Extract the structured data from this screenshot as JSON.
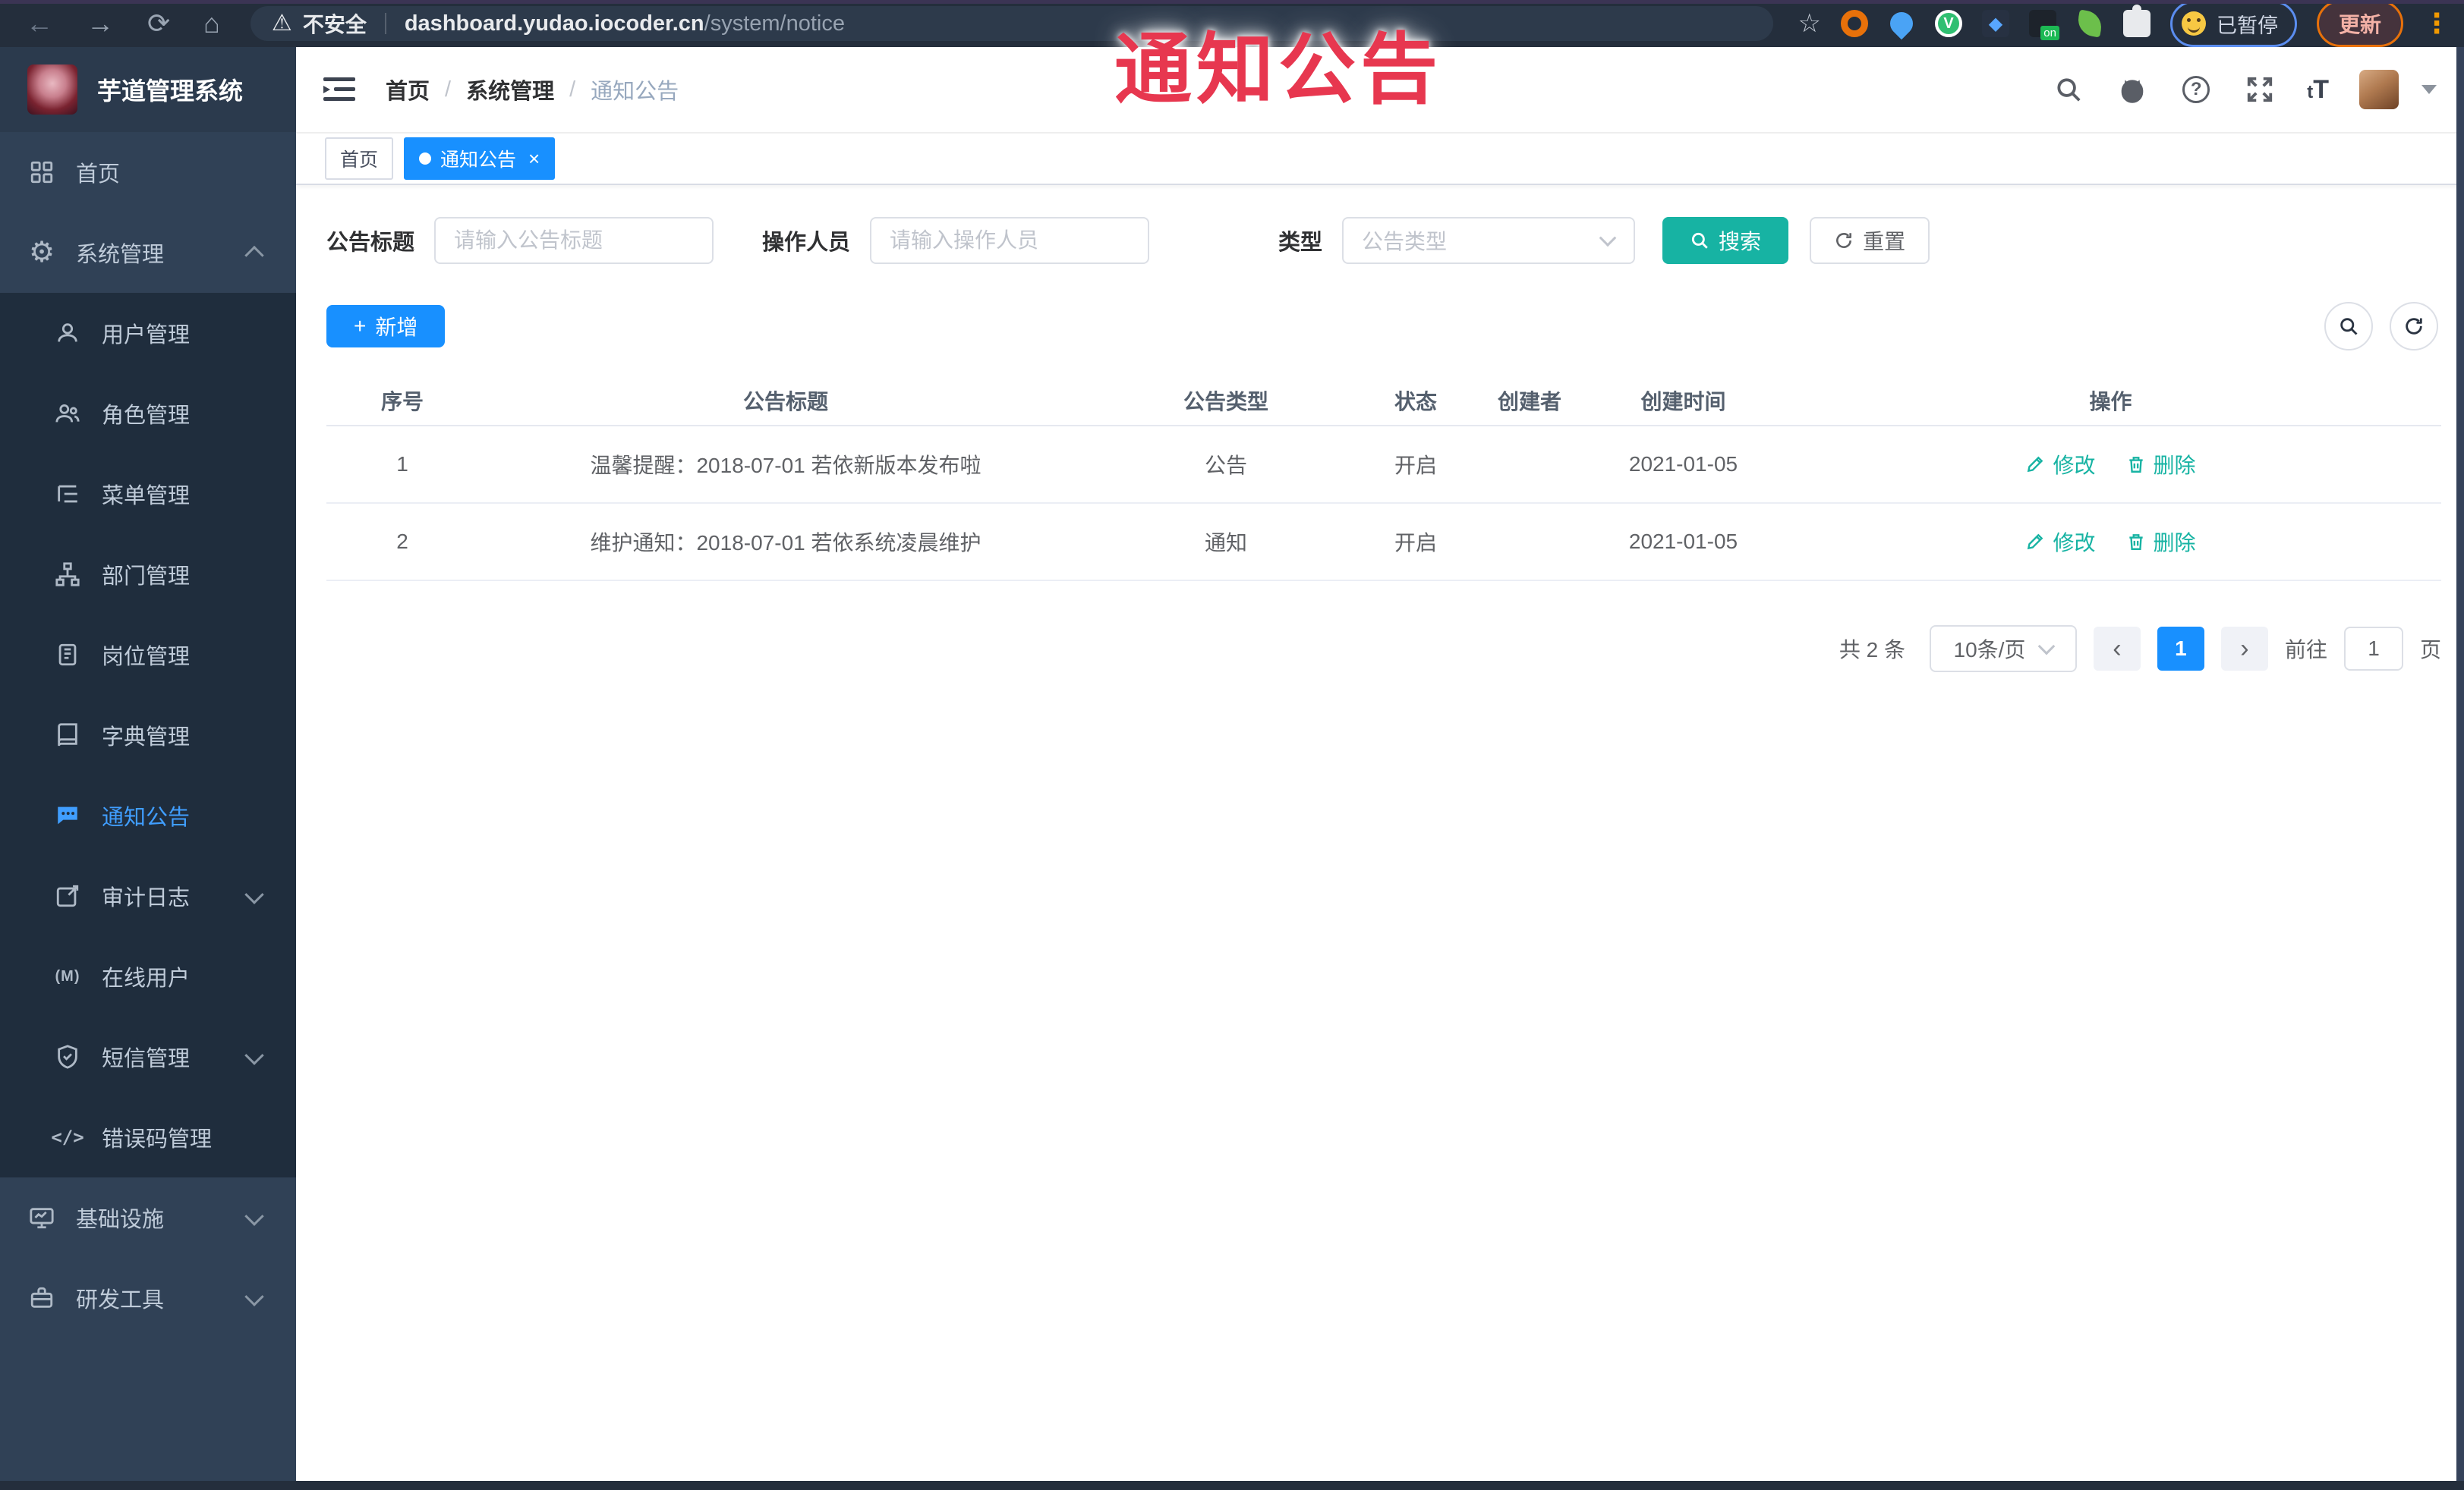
{
  "overlay": {
    "text": "通知公告",
    "color": "#e7374f"
  },
  "browser": {
    "security_label": "不安全",
    "url_host": "dashboard.yudao.iocoder.cn",
    "url_path": "/system/notice",
    "paused_label": "已暂停",
    "update_label": "更新",
    "ext_badge": "on",
    "kebab": "⋮",
    "back": "←",
    "forward": "→",
    "reload": "⟳",
    "home": "⌂",
    "star": "☆",
    "warning": "⚠"
  },
  "sidebar": {
    "title": "芋道管理系统",
    "items": [
      {
        "label": "首页",
        "icon": "dashboard-icon"
      },
      {
        "label": "系统管理",
        "icon": "gear-icon",
        "arrow": "up"
      },
      {
        "label": "用户管理",
        "icon": "user-icon"
      },
      {
        "label": "角色管理",
        "icon": "users-icon"
      },
      {
        "label": "菜单管理",
        "icon": "menu-tree-icon"
      },
      {
        "label": "部门管理",
        "icon": "org-tree-icon"
      },
      {
        "label": "岗位管理",
        "icon": "badge-icon"
      },
      {
        "label": "字典管理",
        "icon": "book-icon"
      },
      {
        "label": "通知公告",
        "icon": "message-icon",
        "active": true
      },
      {
        "label": "审计日志",
        "icon": "log-icon",
        "arrow": "down"
      },
      {
        "label": "在线用户",
        "icon": "online-user-icon"
      },
      {
        "label": "短信管理",
        "icon": "shield-icon",
        "arrow": "down"
      },
      {
        "label": "错误码管理",
        "icon": "code-icon"
      },
      {
        "label": "基础设施",
        "icon": "monitor-icon",
        "arrow": "down"
      },
      {
        "label": "研发工具",
        "icon": "toolbox-icon",
        "arrow": "down"
      }
    ],
    "gear_glyph": "⚙",
    "code_glyph": "</>"
  },
  "navbar": {
    "breadcrumb": [
      "首页",
      "系统管理",
      "通知公告"
    ],
    "separator": "/",
    "icons": [
      "search-icon",
      "github-icon",
      "question-icon",
      "fullscreen-icon",
      "font-size-icon",
      "avatar",
      "caret-down-icon"
    ],
    "font_size_glyph_small": "t",
    "font_size_glyph_big": "T",
    "question_glyph": "?"
  },
  "tags": [
    {
      "label": "首页",
      "active": false
    },
    {
      "label": "通知公告",
      "active": true,
      "close": "×"
    }
  ],
  "filters": {
    "title_label": "公告标题",
    "title_placeholder": "请输入公告标题",
    "operator_label": "操作人员",
    "operator_placeholder": "请输入操作人员",
    "type_label": "类型",
    "type_placeholder": "公告类型",
    "search_label": "搜索",
    "reset_label": "重置"
  },
  "toolbar": {
    "add_label": "新增",
    "plus": "+"
  },
  "table": {
    "columns": [
      "序号",
      "公告标题",
      "公告类型",
      "状态",
      "创建者",
      "创建时间",
      "操作"
    ],
    "rows": [
      {
        "seq": "1",
        "title": "温馨提醒：2018-07-01 若依新版本发布啦",
        "type": "公告",
        "status": "开启",
        "creator": "",
        "created": "2021-01-05",
        "edit": "修改",
        "delete": "删除"
      },
      {
        "seq": "2",
        "title": "维护通知：2018-07-01 若依系统凌晨维护",
        "type": "通知",
        "status": "开启",
        "creator": "",
        "created": "2021-01-05",
        "edit": "修改",
        "delete": "删除"
      }
    ]
  },
  "pagination": {
    "total": "共 2 条",
    "size": "10条/页",
    "prev": "‹",
    "next": "›",
    "page": "1",
    "goto_label": "前往",
    "goto_value": "1",
    "unit": "页"
  },
  "colors": {
    "primary_blue": "#1890ff",
    "sidebar_active_blue": "#409eff",
    "teal_accent": "#17b3a3",
    "overlay_red": "#e7374f",
    "sidebar_bg": "#304156",
    "submenu_bg": "#1f2d3d",
    "chrome_bg": "#242e3c"
  }
}
